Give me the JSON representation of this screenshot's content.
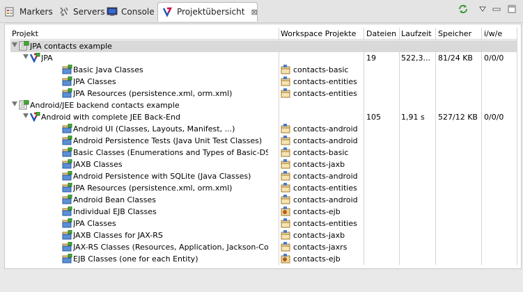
{
  "tabs": [
    {
      "label": "Markers",
      "icon": "markers-icon"
    },
    {
      "label": "Servers",
      "icon": "servers-icon"
    },
    {
      "label": "Console",
      "icon": "console-icon"
    },
    {
      "label": "Projektübersicht",
      "icon": "overview-icon",
      "active": true
    }
  ],
  "close_glyph": "⊠",
  "toolbar": {
    "refresh_icon": "refresh-icon",
    "menu_icon": "view-menu-icon",
    "minimize_icon": "minimize-icon",
    "maximize_icon": "maximize-icon"
  },
  "columns": [
    "Projekt",
    "Workspace Projekte",
    "Dateien",
    "Laufzeit",
    "Speicher",
    "i/w/e"
  ],
  "rows": [
    {
      "level": 0,
      "expanded": true,
      "type": "group",
      "name": "JPA contacts example",
      "workspace": "",
      "files": "",
      "runtime": "",
      "memory": "",
      "iwe": ""
    },
    {
      "level": 1,
      "expanded": true,
      "type": "project",
      "name": "JPA",
      "workspace": "",
      "files": "19",
      "runtime": "522,3...",
      "memory": "81/24 KB",
      "iwe": "0/0/0"
    },
    {
      "level": 2,
      "type": "module",
      "name": "Basic Java Classes",
      "workspace": "contacts-basic",
      "wp_type": "folder"
    },
    {
      "level": 2,
      "type": "module",
      "name": "JPA Classes",
      "workspace": "contacts-entities",
      "wp_type": "folder"
    },
    {
      "level": 2,
      "type": "module",
      "name": "JPA Resources (persistence.xml, orm.xml)",
      "workspace": "contacts-entities",
      "wp_type": "folder"
    },
    {
      "level": 0,
      "expanded": true,
      "type": "group",
      "name": "Android/JEE backend contacts example",
      "workspace": "",
      "files": "",
      "runtime": "",
      "memory": "",
      "iwe": ""
    },
    {
      "level": 1,
      "expanded": true,
      "type": "project",
      "name": "Android with complete JEE Back-End",
      "workspace": "",
      "files": "105",
      "runtime": "1,91 s",
      "memory": "527/12 KB",
      "iwe": "0/0/0"
    },
    {
      "level": 2,
      "type": "module",
      "name": "Android UI (Classes, Layouts, Manifest, ...)",
      "workspace": "contacts-android",
      "wp_type": "folder"
    },
    {
      "level": 2,
      "type": "module",
      "name": "Android Persistence Tests (Java Unit Test Classes)",
      "workspace": "contacts-android",
      "wp_type": "folder"
    },
    {
      "level": 2,
      "type": "module",
      "name": "Basic Classes (Enumerations and Types of Basic-DSL)",
      "workspace": "contacts-basic",
      "wp_type": "folder"
    },
    {
      "level": 2,
      "type": "module",
      "name": "JAXB Classes",
      "workspace": "contacts-jaxb",
      "wp_type": "folder"
    },
    {
      "level": 2,
      "type": "module",
      "name": "Android Persistence with SQLite (Java Classes)",
      "workspace": "contacts-android",
      "wp_type": "folder"
    },
    {
      "level": 2,
      "type": "module",
      "name": "JPA Resources (persistence.xml, orm.xml)",
      "workspace": "contacts-entities",
      "wp_type": "folder"
    },
    {
      "level": 2,
      "type": "module",
      "name": "Android Bean Classes",
      "workspace": "contacts-android",
      "wp_type": "folder"
    },
    {
      "level": 2,
      "type": "module",
      "name": "Individual EJB Classes",
      "workspace": "contacts-ejb",
      "wp_type": "ejb"
    },
    {
      "level": 2,
      "type": "module",
      "name": "JPA Classes",
      "workspace": "contacts-entities",
      "wp_type": "folder"
    },
    {
      "level": 2,
      "type": "module",
      "name": "JAXB Classes for JAX-RS",
      "workspace": "contacts-jaxb",
      "wp_type": "folder"
    },
    {
      "level": 2,
      "type": "module",
      "name": "JAX-RS Classes (Resources, Application, Jackson-Config...",
      "workspace": "contacts-jaxrs",
      "wp_type": "folder"
    },
    {
      "level": 2,
      "type": "module",
      "name": "EJB Classes (one for each Entity)",
      "workspace": "contacts-ejb",
      "wp_type": "ejb"
    }
  ],
  "colors": {
    "selection": "#d9d9d9",
    "grid": "#d4d4d4",
    "accent_blue": "#2255bb",
    "accent_red": "#cc1144",
    "module_green": "#44aa33"
  }
}
